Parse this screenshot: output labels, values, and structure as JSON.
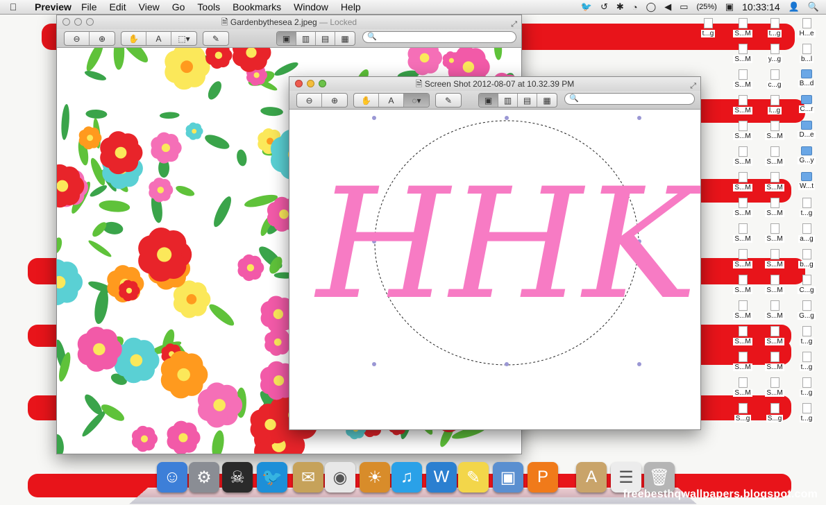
{
  "menubar": {
    "app_name": "Preview",
    "menus": [
      "File",
      "Edit",
      "View",
      "Go",
      "Tools",
      "Bookmarks",
      "Window",
      "Help"
    ],
    "battery": "(25%)",
    "clock": "10:33:14",
    "status_icons": [
      "twitter-icon",
      "time-machine-icon",
      "bluetooth-icon",
      "wifi-icon",
      "chat-icon",
      "volume-icon",
      "battery-icon",
      "input-menu-icon",
      "user-icon",
      "spotlight-icon"
    ]
  },
  "window_back": {
    "title": "Gardenbythesea 2.jpeg",
    "title_suffix": "— Locked",
    "search_placeholder": ""
  },
  "window_front": {
    "title": "Screen Shot 2012-08-07 at 10.32.39 PM",
    "search_placeholder": "",
    "monogram_text": "HHK",
    "monogram_color": "#f77bc4"
  },
  "desktop_icons": [
    [
      "t...g",
      "S...M",
      "t...g",
      "H...e"
    ],
    [
      "",
      "S...M",
      "y...g",
      "b...l"
    ],
    [
      "",
      "S...M",
      "c...g",
      "B...d"
    ],
    [
      "",
      "S...M",
      "l...g",
      "C...r"
    ],
    [
      "",
      "S...M",
      "S...M",
      "D...e"
    ],
    [
      "",
      "S...M",
      "S...M",
      "G...y"
    ],
    [
      "",
      "S...M",
      "S...M",
      "W...t"
    ],
    [
      "",
      "S...M",
      "S...M",
      "t...g"
    ],
    [
      "",
      "S...M",
      "S...M",
      "a...g"
    ],
    [
      "",
      "S...M",
      "S...M",
      "b...g"
    ],
    [
      "",
      "S...M",
      "S...M",
      "C...g"
    ],
    [
      "",
      "S...M",
      "S...M",
      "G...g"
    ],
    [
      "",
      "S...M",
      "S...M",
      "t...g"
    ],
    [
      "",
      "S...M",
      "S...M",
      "t...g"
    ],
    [
      "",
      "S...M",
      "S...M",
      "t...g"
    ],
    [
      "",
      "S...g",
      "S...g",
      "t...g"
    ]
  ],
  "dock_items": [
    "finder-icon",
    "system-preferences-icon",
    "game-icon",
    "twitter-app-icon",
    "mail-icon",
    "chrome-icon",
    "iphoto-icon",
    "itunes-icon",
    "wordpress-app-icon",
    "stickies-icon",
    "preview-app-icon",
    "powerpoint-icon",
    "applications-stack-icon",
    "documents-stack-icon",
    "trash-icon"
  ],
  "watermark": "freebesthqwallpapers.blogspot.com",
  "colors": {
    "stripe": "#e8141a",
    "monogram": "#f77bc4"
  }
}
